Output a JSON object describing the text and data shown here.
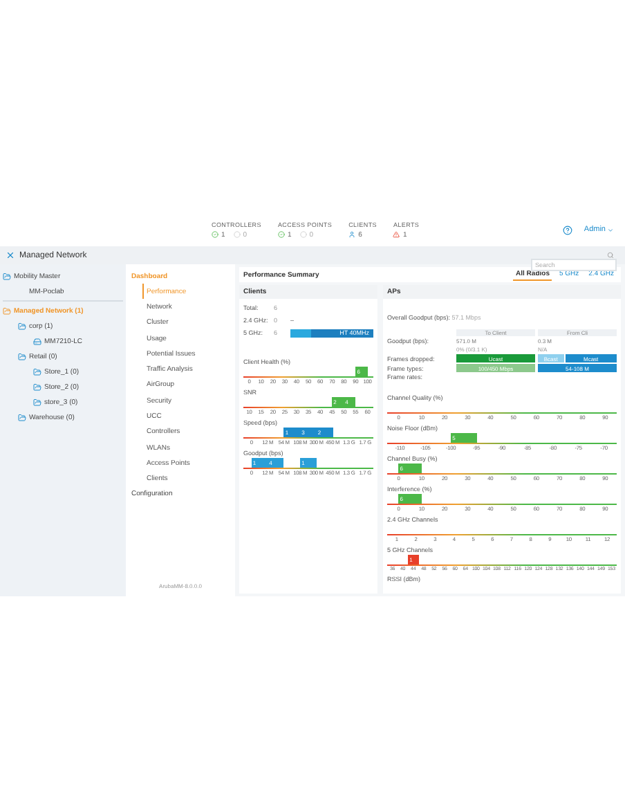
{
  "summary": [
    {
      "label": "CONTROLLERS",
      "kind": "updown",
      "up": "1",
      "down": "0"
    },
    {
      "label": "ACCESS POINTS",
      "kind": "updown",
      "up": "1",
      "down": "0"
    },
    {
      "label": "CLIENTS",
      "kind": "clients",
      "value": "6"
    },
    {
      "label": "ALERTS",
      "kind": "alerts",
      "value": "1"
    }
  ],
  "user": {
    "name": "Admin"
  },
  "nav": {
    "title": "Managed Network",
    "search": {
      "placeholder": "Search"
    }
  },
  "tree": [
    {
      "label": "Mobility Master",
      "kind": "folder",
      "selected": false,
      "children": [
        {
          "label": "MM-Poclab",
          "kind": "plain",
          "selected": false
        }
      ]
    },
    {
      "label": "Managed Network (1)",
      "kind": "folder",
      "selected": true,
      "children": [
        {
          "label": "corp (1)",
          "kind": "folder",
          "selected": false,
          "children": [
            {
              "label": "MM7210-LC",
              "kind": "device",
              "selected": false
            }
          ]
        },
        {
          "label": "Retail (0)",
          "kind": "folder",
          "selected": false,
          "children": [
            {
              "label": "Store_1 (0)",
              "kind": "folder",
              "selected": false
            },
            {
              "label": "Store_2 (0)",
              "kind": "folder",
              "selected": false
            },
            {
              "label": "store_3 (0)",
              "kind": "folder",
              "selected": false
            }
          ]
        },
        {
          "label": "Warehouse (0)",
          "kind": "folder",
          "selected": false
        }
      ]
    }
  ],
  "menu": [
    {
      "label": "Dashboard",
      "expanded": true,
      "children": [
        {
          "label": "Performance",
          "selected": true
        },
        {
          "label": "Network",
          "selected": false
        },
        {
          "label": "Cluster",
          "selected": false
        },
        {
          "label": "Usage",
          "selected": false
        },
        {
          "label": "Potential Issues",
          "selected": false
        },
        {
          "label": "Traffic Analysis",
          "selected": false
        },
        {
          "label": "AirGroup",
          "selected": false
        },
        {
          "label": "Security",
          "selected": false
        },
        {
          "label": "UCC",
          "selected": false
        },
        {
          "label": "Controllers",
          "selected": false
        },
        {
          "label": "WLANs",
          "selected": false
        },
        {
          "label": "Access Points",
          "selected": false
        },
        {
          "label": "Clients",
          "selected": false
        }
      ]
    },
    {
      "label": "Configuration",
      "expanded": false
    }
  ],
  "version": "ArubaMM-8.0.0.0",
  "main": {
    "title": "Performance Summary",
    "radio_tabs": [
      {
        "label": "All Radios",
        "selected": true
      },
      {
        "label": "5 GHz",
        "selected": false
      },
      {
        "label": "2.4 GHz",
        "selected": false
      }
    ],
    "clients": {
      "title": "Clients",
      "counts": [
        {
          "label": "Total:",
          "value": "6"
        },
        {
          "label": "2.4 GHz:",
          "value": "0",
          "note": "–"
        },
        {
          "label": "5 GHz:",
          "value": "6",
          "bar": {
            "label": "HT 40MHz",
            "level": 1
          }
        }
      ],
      "metrics": [
        {
          "title": "Client Health (%)",
          "kind": "bins",
          "color": "#4cb848",
          "ticks": [
            "0",
            "10",
            "20",
            "30",
            "40",
            "50",
            "60",
            "70",
            "80",
            "90",
            "100"
          ],
          "bins": [
            {
              "filled": false
            },
            {
              "filled": false
            },
            {
              "filled": false
            },
            {
              "filled": false
            },
            {
              "filled": false
            },
            {
              "filled": false
            },
            {
              "filled": false
            },
            {
              "filled": false
            },
            {
              "filled": false
            },
            {
              "filled": true,
              "count": "6"
            }
          ]
        },
        {
          "title": "SNR",
          "kind": "bins",
          "color": "#4cb848",
          "ticks": [
            "10",
            "15",
            "20",
            "25",
            "30",
            "35",
            "40",
            "45",
            "50",
            "55",
            "60"
          ],
          "bins": [
            {
              "filled": false
            },
            {
              "filled": false
            },
            {
              "filled": false
            },
            {
              "filled": false
            },
            {
              "filled": false
            },
            {
              "filled": false
            },
            {
              "filled": false
            },
            {
              "filled": true,
              "count": "2"
            },
            {
              "filled": true,
              "count": "4"
            },
            {
              "filled": false
            }
          ]
        },
        {
          "title": "Speed (bps)",
          "kind": "bins",
          "color": "#1d8ccc",
          "ticks": [
            "0",
            "12 M",
            "54 M",
            "108 M",
            "300 M",
            "450 M",
            "1.3 G",
            "1.7 G"
          ],
          "bins": [
            {
              "filled": false
            },
            {
              "filled": false
            },
            {
              "filled": true,
              "count": "1"
            },
            {
              "filled": true,
              "count": "3"
            },
            {
              "filled": true,
              "count": "2"
            },
            {
              "filled": false
            },
            {
              "filled": false
            }
          ]
        },
        {
          "title": "Goodput (bps)",
          "kind": "bins",
          "color": "#2a9fd8",
          "ticks": [
            "0",
            "12 M",
            "54 M",
            "108 M",
            "300 M",
            "450 M",
            "1.3 G",
            "1.7 G"
          ],
          "bins": [
            {
              "filled": true,
              "count": "1"
            },
            {
              "filled": true,
              "count": "4"
            },
            {
              "filled": false
            },
            {
              "filled": true,
              "count": "1"
            },
            {
              "filled": false
            },
            {
              "filled": false
            },
            {
              "filled": false
            }
          ]
        }
      ]
    },
    "aps": {
      "title": "APs",
      "overall_label": "Overall Goodput (bps):",
      "overall_value": "57.1 Mbps",
      "columns": [
        "To Client",
        "From Cli"
      ],
      "rows": [
        {
          "label": "Goodput (bps):",
          "kind": "text",
          "to": "571.0 M",
          "from": "0.3 M"
        },
        {
          "kind": "note",
          "to": "0% (0/3.1 K)",
          "from": "N/A"
        },
        {
          "label": "Frames dropped:",
          "kind": "bars",
          "to": [
            {
              "label": "Ucast",
              "color": "#1a9a3a"
            }
          ],
          "from": [
            {
              "label": "Bcast",
              "color": "#8fd0ee"
            },
            {
              "label": "Mcast",
              "color": "#1d8ccc"
            }
          ]
        },
        {
          "label": "Frame types:",
          "kind": "bars",
          "to": [
            {
              "label": "100/450 Mbps",
              "color": "#8cc98c"
            }
          ],
          "from": [
            {
              "label": "54-108 M",
              "color": "#1d8ccc"
            }
          ]
        },
        {
          "label": "Frame rates:",
          "kind": "label"
        }
      ],
      "metrics": [
        {
          "title": "Channel Quality (%)",
          "kind": "bins",
          "ticks": [
            "0",
            "10",
            "20",
            "30",
            "40",
            "50",
            "60",
            "70",
            "80",
            "90"
          ],
          "bins": [
            {
              "filled": false
            },
            {
              "filled": false
            },
            {
              "filled": false
            },
            {
              "filled": false
            },
            {
              "filled": false
            },
            {
              "filled": false
            },
            {
              "filled": false
            },
            {
              "filled": false
            },
            {
              "filled": false
            }
          ]
        },
        {
          "title": "Noise Floor (dBm)",
          "kind": "bins",
          "color": "#4cb848",
          "ticks": [
            "-110",
            "-105",
            "-100",
            "-95",
            "-90",
            "-85",
            "-80",
            "-75",
            "-70"
          ],
          "bins": [
            {
              "filled": false
            },
            {
              "filled": false
            },
            {
              "filled": true,
              "count": "5"
            },
            {
              "filled": false
            },
            {
              "filled": false
            },
            {
              "filled": false
            },
            {
              "filled": false
            },
            {
              "filled": false
            }
          ]
        },
        {
          "title": "Channel Busy (%)",
          "kind": "bins",
          "color": "#4cb848",
          "ticks": [
            "0",
            "10",
            "20",
            "30",
            "40",
            "50",
            "60",
            "70",
            "80",
            "90"
          ],
          "bins": [
            {
              "filled": true,
              "count": "6"
            },
            {
              "filled": false
            },
            {
              "filled": false
            },
            {
              "filled": false
            },
            {
              "filled": false
            },
            {
              "filled": false
            },
            {
              "filled": false
            },
            {
              "filled": false
            },
            {
              "filled": false
            }
          ]
        },
        {
          "title": "Interference (%)",
          "kind": "bins",
          "color": "#4cb848",
          "ticks": [
            "0",
            "10",
            "20",
            "30",
            "40",
            "50",
            "60",
            "70",
            "80",
            "90"
          ],
          "bins": [
            {
              "filled": true,
              "count": "6"
            },
            {
              "filled": false
            },
            {
              "filled": false
            },
            {
              "filled": false
            },
            {
              "filled": false
            },
            {
              "filled": false
            },
            {
              "filled": false
            },
            {
              "filled": false
            },
            {
              "filled": false
            }
          ]
        },
        {
          "title": "2.4 GHz Channels",
          "kind": "channels",
          "ticks": [
            "1",
            "2",
            "3",
            "4",
            "5",
            "6",
            "7",
            "8",
            "9",
            "10",
            "11",
            "12"
          ],
          "bins": [
            {
              "filled": false
            },
            {
              "filled": false
            },
            {
              "filled": false
            },
            {
              "filled": false
            },
            {
              "filled": false
            },
            {
              "filled": false
            },
            {
              "filled": false
            },
            {
              "filled": false
            },
            {
              "filled": false
            },
            {
              "filled": false
            },
            {
              "filled": false
            },
            {
              "filled": false
            }
          ]
        },
        {
          "title": "5 GHz Channels",
          "kind": "channels",
          "color": "#e8402a",
          "ticks": [
            "36",
            "40",
            "44",
            "48",
            "52",
            "56",
            "60",
            "64",
            "100",
            "104",
            "108",
            "112",
            "116",
            "120",
            "124",
            "128",
            "132",
            "136",
            "140",
            "144",
            "149",
            "153"
          ],
          "bins": [
            {
              "filled": false
            },
            {
              "filled": false
            },
            {
              "filled": true,
              "count": "1"
            },
            {
              "filled": false
            },
            {
              "filled": false
            },
            {
              "filled": false
            },
            {
              "filled": false
            },
            {
              "filled": false
            },
            {
              "filled": false
            },
            {
              "filled": false
            },
            {
              "filled": false
            },
            {
              "filled": false
            },
            {
              "filled": false
            },
            {
              "filled": false
            },
            {
              "filled": false
            },
            {
              "filled": false
            },
            {
              "filled": false
            },
            {
              "filled": false
            },
            {
              "filled": false
            },
            {
              "filled": false
            },
            {
              "filled": false
            },
            {
              "filled": false
            }
          ]
        },
        {
          "title": "RSSI (dBm)",
          "kind": "title"
        }
      ]
    }
  }
}
